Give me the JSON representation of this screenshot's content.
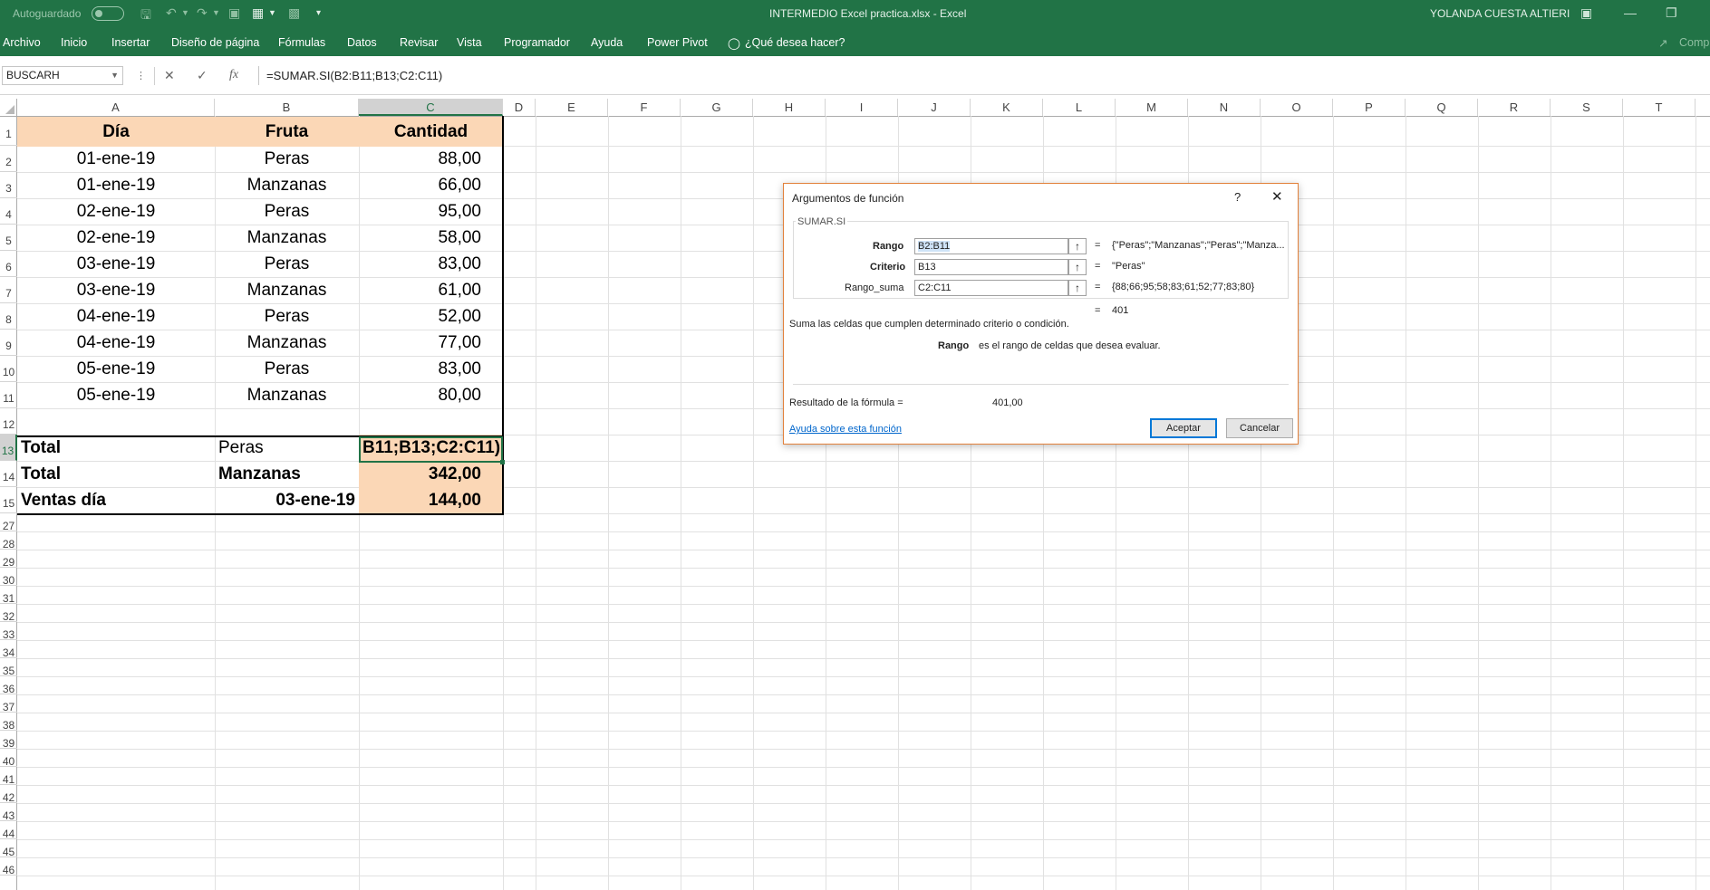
{
  "titlebar": {
    "autosave_label": "Autoguardado",
    "document_title": "INTERMEDIO Excel practica.xlsx  -  Excel",
    "user_name": "YOLANDA CUESTA ALTIERI"
  },
  "ribbon": {
    "tabs": [
      "Archivo",
      "Inicio",
      "Insertar",
      "Diseño de página",
      "Fórmulas",
      "Datos",
      "Revisar",
      "Vista",
      "Programador",
      "Ayuda",
      "Power Pivot"
    ],
    "tell_me": "¿Qué desea hacer?",
    "share_label": "Comp"
  },
  "formula_bar": {
    "name_box": "BUSCARH",
    "fx_label": "fx",
    "formula": "=SUMAR.SI(B2:B11;B13;C2:C11)"
  },
  "sheet": {
    "columns": [
      "A",
      "B",
      "C",
      "D",
      "E",
      "F",
      "G",
      "H",
      "I",
      "J",
      "K",
      "L",
      "M",
      "N",
      "O",
      "P",
      "Q",
      "R",
      "S",
      "T"
    ],
    "selected_column": "C",
    "selected_row": "13",
    "row_numbers": [
      "1",
      "2",
      "3",
      "4",
      "5",
      "6",
      "7",
      "8",
      "9",
      "10",
      "11",
      "12",
      "13",
      "14",
      "15",
      "27",
      "28",
      "29",
      "30",
      "31",
      "32",
      "33",
      "34",
      "35",
      "36",
      "37",
      "38",
      "39",
      "40",
      "41",
      "42",
      "43",
      "44",
      "45",
      "46"
    ],
    "header": {
      "dia": "Día",
      "fruta": "Fruta",
      "cantidad": "Cantidad"
    },
    "rows": [
      {
        "dia": "01-ene-19",
        "fruta": "Peras",
        "cantidad": "88,00"
      },
      {
        "dia": "01-ene-19",
        "fruta": "Manzanas",
        "cantidad": "66,00"
      },
      {
        "dia": "02-ene-19",
        "fruta": "Peras",
        "cantidad": "95,00"
      },
      {
        "dia": "02-ene-19",
        "fruta": "Manzanas",
        "cantidad": "58,00"
      },
      {
        "dia": "03-ene-19",
        "fruta": "Peras",
        "cantidad": "83,00"
      },
      {
        "dia": "03-ene-19",
        "fruta": "Manzanas",
        "cantidad": "61,00"
      },
      {
        "dia": "04-ene-19",
        "fruta": "Peras",
        "cantidad": "52,00"
      },
      {
        "dia": "04-ene-19",
        "fruta": "Manzanas",
        "cantidad": "77,00"
      },
      {
        "dia": "05-ene-19",
        "fruta": "Peras",
        "cantidad": "83,00"
      },
      {
        "dia": "05-ene-19",
        "fruta": "Manzanas",
        "cantidad": "80,00"
      }
    ],
    "summary": [
      {
        "label": "Total",
        "b": "Peras",
        "c": "B11;B13;C2:C11)"
      },
      {
        "label": "Total",
        "b": "Manzanas",
        "c": "342,00"
      },
      {
        "label": "Ventas día",
        "b": "03-ene-19",
        "c": "144,00"
      }
    ],
    "colors": {
      "header_fill": "#fbd7b6",
      "excel_green": "#217346"
    }
  },
  "dialog": {
    "title": "Argumentos de función",
    "help_glyph": "?",
    "function_name": "SUMAR.SI",
    "args": [
      {
        "label": "Rango",
        "value": "B2:B11",
        "result": "{\"Peras\";\"Manzanas\";\"Peras\";\"Manza..."
      },
      {
        "label": "Criterio",
        "value": "B13",
        "result": "\"Peras\""
      },
      {
        "label": "Rango_suma",
        "value": "C2:C11",
        "result": "{88;66;95;58;83;61;52;77;83;80}"
      }
    ],
    "equals": "=",
    "preview_result": "401",
    "description": "Suma las celdas que cumplen determinado criterio o condición.",
    "arg_help_name": "Rango",
    "arg_help_text": "es el rango de celdas que desea evaluar.",
    "formula_result_label": "Resultado de la fórmula =",
    "formula_result_value": "401,00",
    "help_link": "Ayuda sobre esta función",
    "ok_button": "Aceptar",
    "cancel_button": "Cancelar"
  }
}
